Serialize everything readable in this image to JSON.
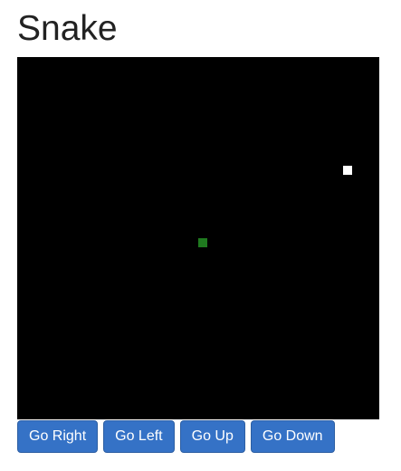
{
  "title": "Snake",
  "game": {
    "board_color": "#000000",
    "snake_color": "#1f7a1f",
    "food_color": "#ffffff"
  },
  "controls": {
    "right_label": "Go Right",
    "left_label": "Go Left",
    "up_label": "Go Up",
    "down_label": "Go Down",
    "button_color": "#3572c6"
  }
}
